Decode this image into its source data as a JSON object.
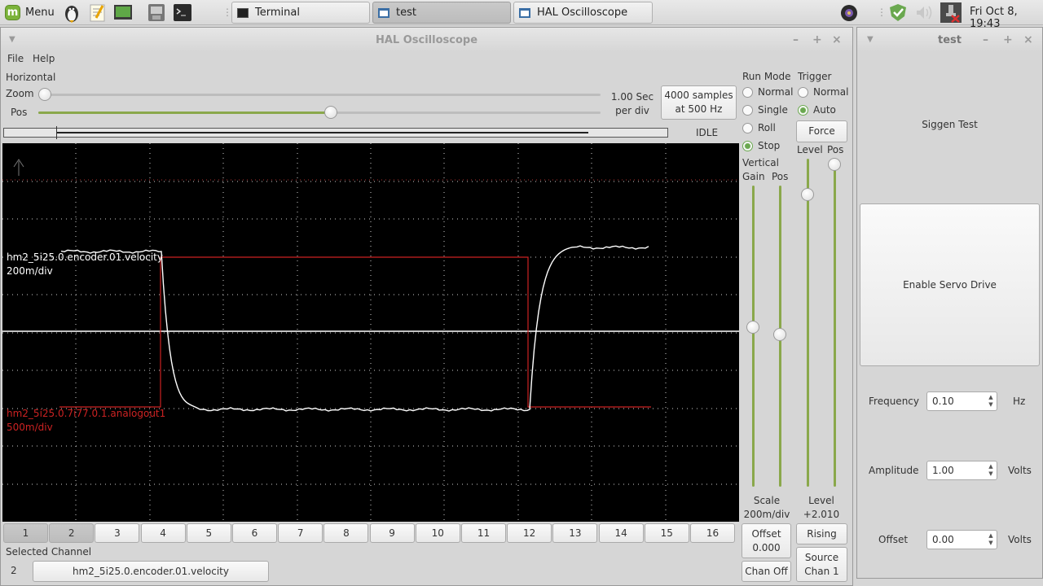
{
  "taskbar": {
    "menu_label": "Menu",
    "tasks": [
      {
        "label": "Terminal"
      },
      {
        "label": "test"
      },
      {
        "label": "HAL Oscilloscope"
      }
    ],
    "clock": "Fri Oct  8, 19:43"
  },
  "scope": {
    "title": "HAL Oscilloscope",
    "menu": {
      "file": "File",
      "help": "Help"
    },
    "horizontal": {
      "label": "Horizontal",
      "zoom_label": "Zoom",
      "pos_label": "Pos",
      "zoom_level": 0.0,
      "pos_level": 0.52,
      "rate_line1": "1.00 Sec",
      "rate_line2": "per div",
      "samples_line1": "4000 samples",
      "samples_line2": "at 500 Hz",
      "state": "IDLE"
    },
    "run_mode": {
      "label": "Run Mode",
      "options": [
        "Normal",
        "Single",
        "Roll",
        "Stop"
      ],
      "selected": "Stop"
    },
    "trigger": {
      "label": "Trigger",
      "options": [
        "Normal",
        "Auto"
      ],
      "selected": "Auto",
      "force_label": "Force",
      "level_label": "Level",
      "pos_label": "Pos",
      "level_readout_label": "Level",
      "level_readout_value": "+2.010",
      "edge_label": "Rising",
      "source_line1": "Source",
      "source_line2": "Chan  1"
    },
    "vertical": {
      "label": "Vertical",
      "gain_label": "Gain",
      "pos_label": "Pos",
      "scale_label": "Scale",
      "scale_value": "200m/div",
      "offset_label": "Offset",
      "offset_value": "0.000",
      "chan_off_label": "Chan Off"
    },
    "traces": [
      {
        "name": "hm2_5i25.0.encoder.01.velocity",
        "scale": "200m/div",
        "color": "#ffffff"
      },
      {
        "name": "hm2_5i25.0.7i77.0.1.analogout1",
        "scale": "500m/div",
        "color": "#cc2222"
      }
    ],
    "channel_tabs": [
      "1",
      "2",
      "3",
      "4",
      "5",
      "6",
      "7",
      "8",
      "9",
      "10",
      "11",
      "12",
      "13",
      "14",
      "15",
      "16"
    ],
    "selected_channel": {
      "label": "Selected Channel",
      "number": "2",
      "name": "hm2_5i25.0.encoder.01.velocity"
    }
  },
  "test_window": {
    "title": "test",
    "heading": "Siggen Test",
    "enable_button": "Enable Servo Drive",
    "fields": [
      {
        "label": "Frequency",
        "value": "0.10",
        "unit": "Hz"
      },
      {
        "label": "Amplitude",
        "value": "1.00",
        "unit": "Volts"
      },
      {
        "label": "Offset",
        "value": "0.00",
        "unit": "Volts"
      }
    ]
  }
}
